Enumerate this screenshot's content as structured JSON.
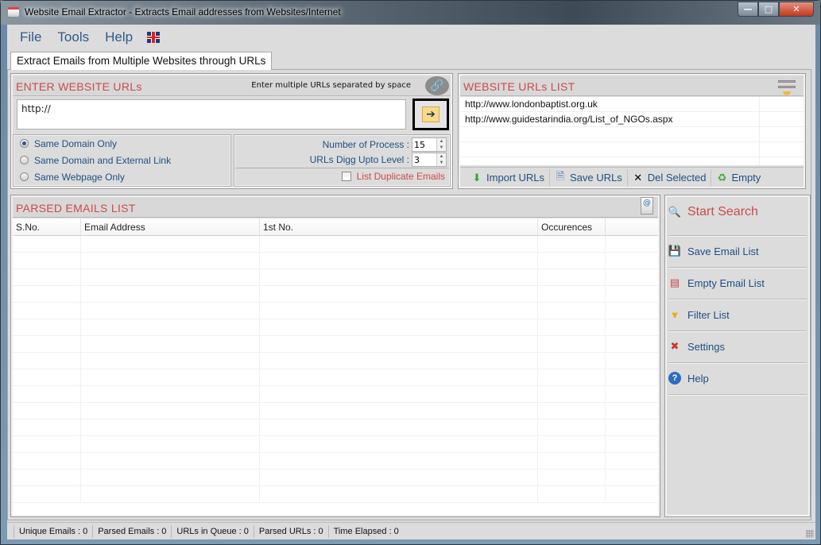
{
  "window": {
    "title": "Website Email Extractor - Extracts Email addresses from Websites/Internet",
    "controls": {
      "minimize": "—",
      "maximize": "□",
      "close": "✕"
    }
  },
  "menu": {
    "items": [
      "File",
      "Tools",
      "Help"
    ],
    "language_icon": "uk-flag-icon"
  },
  "tab": {
    "label": "Extract Emails from Multiple Websites through URLs"
  },
  "enter_panel": {
    "title": "ENTER WEBSITE URLs",
    "hint": "Enter multiple URLs separated by space",
    "url_value": "http://",
    "link_icon": "link-icon",
    "go_icon": "➔",
    "scope_options": [
      {
        "label": "Same Domain Only",
        "selected": true
      },
      {
        "label": "Same Domain and External Link",
        "selected": false
      },
      {
        "label": "Same Webpage Only",
        "selected": false
      }
    ],
    "processes_label": "Number of Process :",
    "processes_value": "15",
    "level_label": "URLs Digg Upto Level :",
    "level_value": "3",
    "duplicate_label": "List Duplicate Emails",
    "duplicate_checked": false
  },
  "urls_panel": {
    "title": "WEBSITE URLs LIST",
    "urls": [
      "http://www.londonbaptist.org.uk",
      "http://www.guidestarindia.org/List_of_NGOs.aspx"
    ],
    "toolbar": {
      "import": "Import URLs",
      "save": "Save URLs",
      "delete": "Del Selected",
      "empty": "Empty"
    }
  },
  "emails_panel": {
    "title": "PARSED EMAILS LIST",
    "columns": [
      "S.No.",
      "Email Address",
      "1st No.",
      "Occurences",
      ""
    ],
    "rows": []
  },
  "actions": {
    "start": "Start Search",
    "save": "Save Email List",
    "empty": "Empty Email List",
    "filter": "Filter List",
    "settings": "Settings",
    "help": "Help"
  },
  "status": {
    "unique": "Unique Emails :  0",
    "parsed": "Parsed Emails :  0",
    "queue": "URLs in Queue :  0",
    "parsed_urls": "Parsed URLs :  0",
    "elapsed": "Time Elapsed :  0"
  },
  "colors": {
    "accent_red": "#cc4a4a",
    "link_blue": "#1f4f82",
    "panel_bg": "#dcdcdc"
  }
}
